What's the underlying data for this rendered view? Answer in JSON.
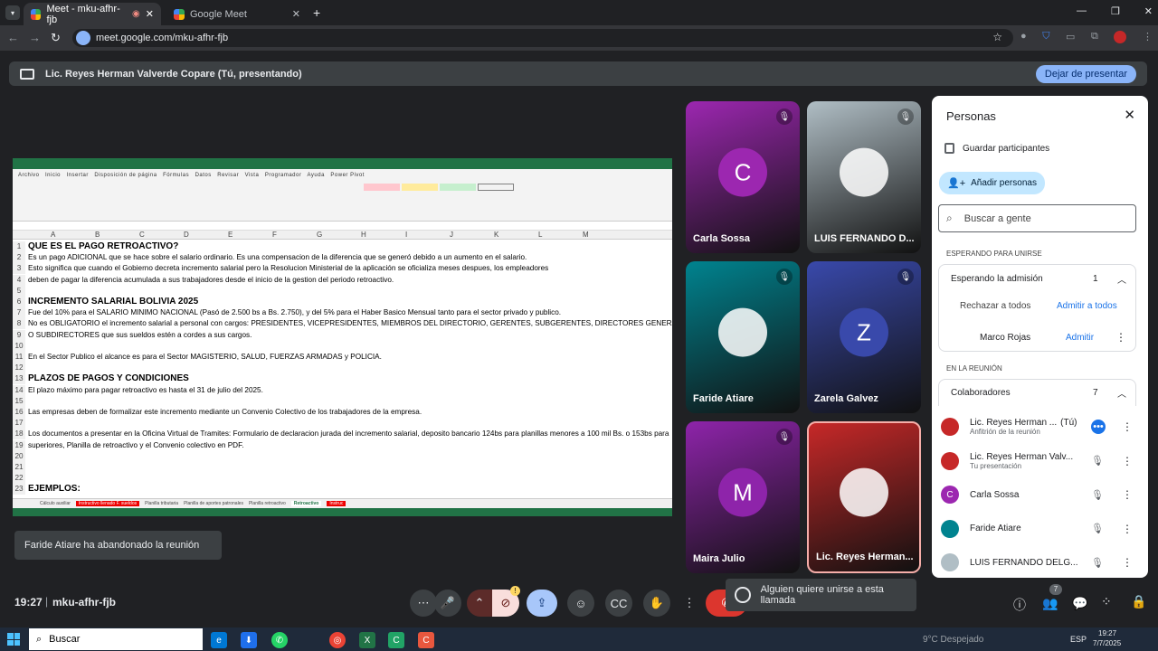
{
  "browser": {
    "tabs": [
      {
        "label": "Meet - mku-afhr-fjb",
        "active": true
      },
      {
        "label": "Google Meet",
        "active": false
      }
    ],
    "url": "meet.google.com/mku-afhr-fjb"
  },
  "presenting": {
    "banner_text": "Lic. Reyes Herman Valverde Copare (Tú, presentando)",
    "stop_label": "Dejar de presentar"
  },
  "sheet": {
    "columns": [
      "A",
      "B",
      "C",
      "D",
      "E",
      "F",
      "G",
      "H",
      "I",
      "J",
      "K",
      "L",
      "M"
    ],
    "rows": [
      {
        "n": "1",
        "text": "QUE ES EL PAGO RETROACTIVO?",
        "bold": true
      },
      {
        "n": "2",
        "text": "Es un pago ADICIONAL que se hace sobre el salario ordinario. Es una compensacion de la diferencia que se generó debido a un aumento en el salario."
      },
      {
        "n": "3",
        "text": "Esto significa que cuando el Gobierno decreta incremento salarial pero la Resolucion Ministerial de la aplicación se oficializa meses despues, los empleadores"
      },
      {
        "n": "4",
        "text": "deben de pagar la diferencia acumulada a sus trabajadores desde el inicio de la gestion del periodo retroactivo."
      },
      {
        "n": "5",
        "text": ""
      },
      {
        "n": "6",
        "text": "INCREMENTO SALARIAL BOLIVIA 2025",
        "bold": true
      },
      {
        "n": "7",
        "text": "Fue del 10% para el SALARIO MINIMO NACIONAL (Pasó de 2.500 bs a Bs. 2.750), y del 5% para el Haber Basico Mensual tanto para el sector privado y publico."
      },
      {
        "n": "8",
        "text": "No es OBLIGATORIO el incremento salarial a personal con cargos: PRESIDENTES, VICEPRESIDENTES, MIEMBROS DEL DIRECTORIO, GERENTES, SUBGERENTES, DIRECTORES GENERALES"
      },
      {
        "n": "9",
        "text": "O SUBDIRECTORES que sus sueldos estén a cordes a sus cargos."
      },
      {
        "n": "10",
        "text": ""
      },
      {
        "n": "11",
        "text": "En el Sector Publico el alcance es para el Sector MAGISTERIO, SALUD, FUERZAS ARMADAS y POLICIA."
      },
      {
        "n": "12",
        "text": ""
      },
      {
        "n": "13",
        "text": "PLAZOS DE PAGOS Y CONDICIONES",
        "bold": true
      },
      {
        "n": "14",
        "text": "El plazo máximo para pagar retroactivo es hasta el 31 de julio del 2025."
      },
      {
        "n": "15",
        "text": ""
      },
      {
        "n": "16",
        "text": "Las empresas deben de formalizar este incremento mediante un Convenio Colectivo de los trabajadores de la empresa."
      },
      {
        "n": "17",
        "text": ""
      },
      {
        "n": "18",
        "text": "Los documentos a presentar en la Oficina Virtual de Tramites: Formulario de declaracion jurada del incremento salarial, deposito bancario 124bs para planillas menores a 100 mil Bs. o 153bs para"
      },
      {
        "n": "19",
        "text": "superiores, Planilla de retroactivo y el Convenio colectivo en PDF."
      },
      {
        "n": "20",
        "text": ""
      },
      {
        "n": "21",
        "text": ""
      },
      {
        "n": "22",
        "text": ""
      },
      {
        "n": "23",
        "text": "EJEMPLOS:",
        "bold": true
      }
    ],
    "tabs": [
      "Cálculo auxiliar",
      "Instructivo llenado F. sueldos",
      "Planilla tributaria",
      "Planilla de aportes patronales",
      "Planilla retroactivo",
      "Retroactivo",
      "Instruc"
    ]
  },
  "tiles": [
    {
      "name": "Carla Sossa",
      "letter": "C",
      "color": "#9c27b0"
    },
    {
      "name": "LUIS FERNANDO D...",
      "letter": "",
      "color": "#b0bec5"
    },
    {
      "name": "Faride Atiare",
      "letter": "",
      "color": "#00838f"
    },
    {
      "name": "Zarela Galvez",
      "letter": "Z",
      "color": "#3949ab"
    },
    {
      "name": "Maira Julio",
      "letter": "M",
      "color": "#8e24aa"
    },
    {
      "name": "Lic. Reyes Herman...",
      "letter": "",
      "color": "#c62828"
    }
  ],
  "people": {
    "title": "Personas",
    "save_label": "Guardar participantes",
    "add_label": "Añadir personas",
    "search_placeholder": "Buscar a gente",
    "waiting_section": "ESPERANDO PARA UNIRSE",
    "waiting_group": "Esperando la admisión",
    "waiting_count": "1",
    "reject_all": "Rechazar a todos",
    "admit_all": "Admitir a todos",
    "waiting_person": "Marco Rojas",
    "admit": "Admitir",
    "in_meeting_section": "EN LA REUNIÓN",
    "collab_group": "Colaboradores",
    "collab_count": "7",
    "members": [
      {
        "name": "Lic. Reyes Herman ...",
        "tag": "(Tú)",
        "sub": "Anfitrión de la reunión",
        "letter": "",
        "color": "#c62828"
      },
      {
        "name": "Lic. Reyes Herman Valv...",
        "tag": "",
        "sub": "Tu presentación",
        "letter": "",
        "color": "#c62828"
      },
      {
        "name": "Carla Sossa",
        "tag": "",
        "sub": "",
        "letter": "C",
        "color": "#9c27b0"
      },
      {
        "name": "Faride Atiare",
        "tag": "",
        "sub": "",
        "letter": "",
        "color": "#00838f"
      },
      {
        "name": "LUIS FERNANDO DELG...",
        "tag": "",
        "sub": "",
        "letter": "",
        "color": "#b0bec5"
      }
    ]
  },
  "toast_left": "Faride Atiare ha abandonado la reunión",
  "toast_join": "Alguien quiere unirse a esta llamada",
  "meeting": {
    "time": "19:27",
    "code": "mku-afhr-fjb",
    "people_badge": "7"
  },
  "taskbar": {
    "search": "Buscar",
    "weather": "9°C Despejado",
    "lang": "ESP",
    "time": "19:27",
    "date": "7/7/2025"
  }
}
